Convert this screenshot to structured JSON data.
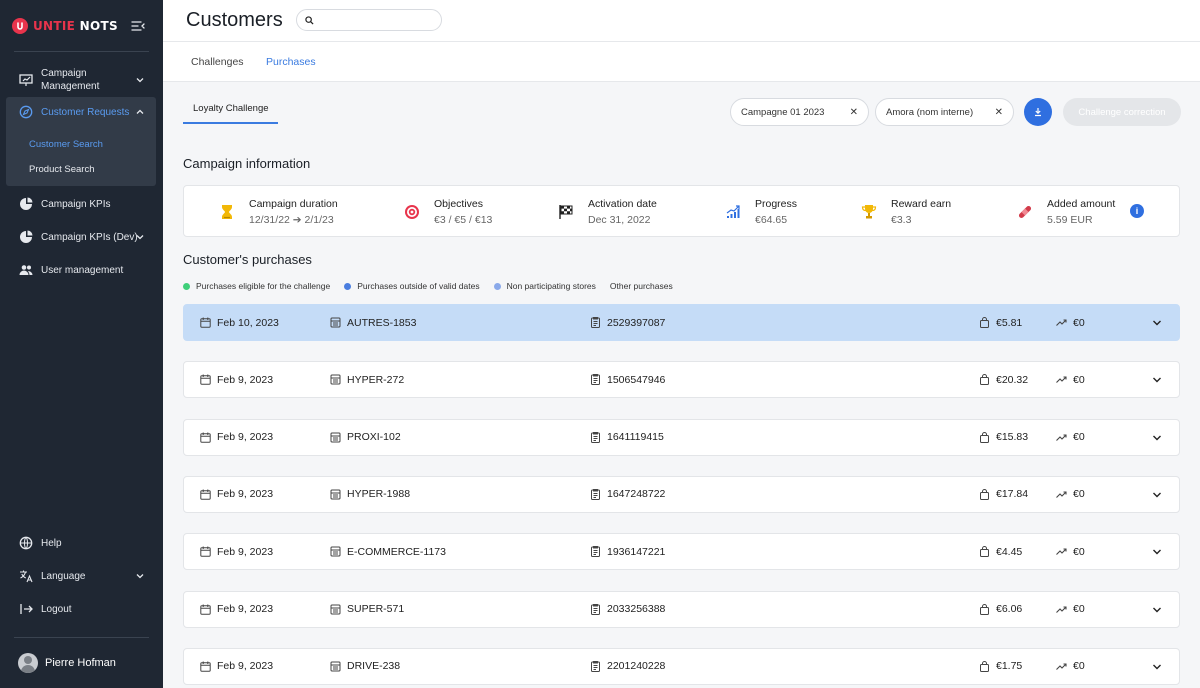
{
  "brand": {
    "name_part1": "UNTIE",
    "name_part2": "NOTS",
    "accent": "#e8344c"
  },
  "sidebar": {
    "nav": [
      {
        "label": "Campaign Management",
        "icon": "presentation-chart-icon",
        "has_chevron": true
      },
      {
        "label": "Customer Requests",
        "icon": "compass-icon",
        "has_chevron": true,
        "expanded": true
      },
      {
        "label": "Campaign KPIs",
        "icon": "pie-chart-icon"
      },
      {
        "label": "Campaign KPIs (Dev)",
        "icon": "pie-chart-icon",
        "has_chevron": true
      },
      {
        "label": "User management",
        "icon": "users-icon"
      }
    ],
    "subitems": [
      {
        "label": "Customer Search",
        "active": true
      },
      {
        "label": "Product Search"
      }
    ],
    "bottom": [
      {
        "label": "Help",
        "icon": "globe-icon"
      },
      {
        "label": "Language",
        "icon": "translate-icon",
        "has_chevron": true
      },
      {
        "label": "Logout",
        "icon": "logout-icon"
      }
    ],
    "user": {
      "name": "Pierre Hofman"
    }
  },
  "header": {
    "title": "Customers",
    "search_placeholder": ""
  },
  "tabs": [
    {
      "label": "Challenges",
      "active": false
    },
    {
      "label": "Purchases",
      "active": true
    }
  ],
  "subtab": {
    "label": "Loyalty Challenge"
  },
  "filters": {
    "campaign": "Campagne 01 2023",
    "brand": "Amora (nom interne)",
    "correction_label": "Challenge correction"
  },
  "campaign_info": {
    "title": "Campaign information",
    "items": [
      {
        "label": "Campaign duration",
        "value": "12/31/22 ➔ 2/1/23",
        "icon": "hourglass-icon"
      },
      {
        "label": "Objectives",
        "value": "€3 / €5 / €13",
        "icon": "target-icon"
      },
      {
        "label": "Activation date",
        "value": "Dec 31, 2022",
        "icon": "checkered-flag-icon"
      },
      {
        "label": "Progress",
        "value": "€64.65",
        "icon": "progress-chart-icon"
      },
      {
        "label": "Reward earn",
        "value": "€3.3",
        "icon": "trophy-icon"
      },
      {
        "label": "Added amount",
        "value": "5.59 EUR",
        "icon": "bandage-icon"
      }
    ],
    "info_glyph": "i"
  },
  "purchases": {
    "title": "Customer's purchases",
    "legend": [
      {
        "label": "Purchases eligible for the challenge",
        "color": "#3fcf7a"
      },
      {
        "label": "Purchases outside of valid dates",
        "color": "#4a7ee0"
      },
      {
        "label": "Non participating stores",
        "color": "#8aa9ea"
      },
      {
        "label": "Other purchases",
        "color": ""
      }
    ],
    "rows": [
      {
        "date": "Feb 10, 2023",
        "store": "AUTRES-1853",
        "receipt": "2529397087",
        "amount": "€5.81",
        "gain": "€0",
        "selected": true
      },
      {
        "date": "Feb 9, 2023",
        "store": "HYPER-272",
        "receipt": "1506547946",
        "amount": "€20.32",
        "gain": "€0"
      },
      {
        "date": "Feb 9, 2023",
        "store": "PROXI-102",
        "receipt": "1641119415",
        "amount": "€15.83",
        "gain": "€0"
      },
      {
        "date": "Feb 9, 2023",
        "store": "HYPER-1988",
        "receipt": "1647248722",
        "amount": "€17.84",
        "gain": "€0"
      },
      {
        "date": "Feb 9, 2023",
        "store": "E-COMMERCE-1173",
        "receipt": "1936147221",
        "amount": "€4.45",
        "gain": "€0"
      },
      {
        "date": "Feb 9, 2023",
        "store": "SUPER-571",
        "receipt": "2033256388",
        "amount": "€6.06",
        "gain": "€0"
      },
      {
        "date": "Feb 9, 2023",
        "store": "DRIVE-238",
        "receipt": "2201240228",
        "amount": "€1.75",
        "gain": "€0"
      }
    ]
  }
}
